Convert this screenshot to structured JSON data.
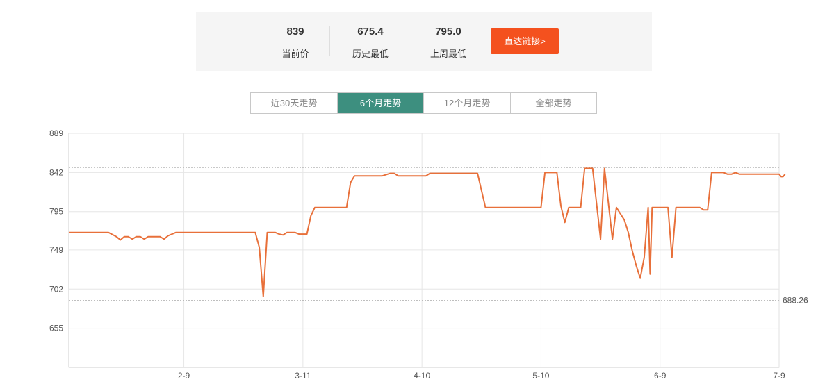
{
  "summary": {
    "current": {
      "value": "839",
      "label": "当前价"
    },
    "historic_low": {
      "value": "675.4",
      "label": "历史最低"
    },
    "last_week_low": {
      "value": "795.0",
      "label": "上周最低"
    },
    "go_button": "直达链接>"
  },
  "tabs": [
    {
      "label": "近30天走势",
      "active": false
    },
    {
      "label": "6个月走势",
      "active": true
    },
    {
      "label": "12个月走势",
      "active": false
    },
    {
      "label": "全部走势",
      "active": false
    }
  ],
  "colors": {
    "line": "#e8703a",
    "accent_tab": "#3d8f7f",
    "button": "#f4511e"
  },
  "chart_data": {
    "type": "line",
    "ylim": [
      608,
      889
    ],
    "y_ticks": [
      "889",
      "842",
      "795",
      "749",
      "702",
      "655"
    ],
    "y_tick_values": [
      889,
      842,
      795,
      749,
      702,
      655
    ],
    "x_tick_labels": [
      "2-9",
      "3-11",
      "4-10",
      "5-10",
      "6-9",
      "7-9"
    ],
    "x_tick_days": [
      40,
      70,
      100,
      130,
      160,
      190
    ],
    "x_range_days": [
      11,
      190
    ],
    "reference_lines": [
      {
        "value": 848,
        "label": ""
      },
      {
        "value": 688.26,
        "label": "688.26"
      }
    ],
    "grid": true,
    "series": [
      {
        "name": "",
        "points": [
          [
            11,
            770
          ],
          [
            21,
            770
          ],
          [
            23,
            765
          ],
          [
            24,
            761
          ],
          [
            25,
            765
          ],
          [
            26,
            765
          ],
          [
            27,
            762
          ],
          [
            28,
            765
          ],
          [
            29,
            765
          ],
          [
            30,
            762
          ],
          [
            31,
            765
          ],
          [
            32,
            765
          ],
          [
            33,
            765
          ],
          [
            34,
            765
          ],
          [
            35,
            762
          ],
          [
            36,
            766
          ],
          [
            38,
            770
          ],
          [
            58,
            770
          ],
          [
            59,
            752
          ],
          [
            60,
            693
          ],
          [
            61,
            770
          ],
          [
            63,
            770
          ],
          [
            64,
            768
          ],
          [
            65,
            767
          ],
          [
            66,
            770
          ],
          [
            68,
            770
          ],
          [
            69,
            768
          ],
          [
            70,
            768
          ],
          [
            71,
            768
          ],
          [
            72,
            790
          ],
          [
            73,
            800
          ],
          [
            81,
            800
          ],
          [
            82,
            830
          ],
          [
            83,
            838
          ],
          [
            90,
            838
          ],
          [
            92,
            841
          ],
          [
            93,
            841
          ],
          [
            94,
            838
          ],
          [
            101,
            838
          ],
          [
            102,
            841
          ],
          [
            114,
            841
          ],
          [
            116,
            800
          ],
          [
            130,
            800
          ],
          [
            131,
            842
          ],
          [
            134,
            842
          ],
          [
            135,
            802
          ],
          [
            136,
            782
          ],
          [
            137,
            800
          ],
          [
            140,
            800
          ],
          [
            141,
            847
          ],
          [
            143,
            847
          ],
          [
            145,
            762
          ],
          [
            146,
            847
          ],
          [
            148,
            762
          ],
          [
            149,
            800
          ],
          [
            151,
            785
          ],
          [
            152,
            770
          ],
          [
            153,
            748
          ],
          [
            154,
            730
          ],
          [
            155,
            715
          ],
          [
            156,
            740
          ],
          [
            157,
            800
          ],
          [
            157.5,
            720
          ],
          [
            158,
            800
          ],
          [
            162,
            800
          ],
          [
            163,
            740
          ],
          [
            164,
            800
          ],
          [
            167,
            800
          ],
          [
            168,
            800
          ],
          [
            170,
            800
          ],
          [
            171,
            797
          ],
          [
            172,
            797
          ],
          [
            173,
            842
          ],
          [
            176,
            842
          ],
          [
            177,
            840
          ],
          [
            178,
            840
          ],
          [
            179,
            842
          ],
          [
            180,
            840
          ],
          [
            181,
            840
          ],
          [
            190,
            840
          ],
          [
            190.5,
            837
          ],
          [
            191,
            837
          ],
          [
            191.5,
            840
          ]
        ]
      }
    ]
  }
}
